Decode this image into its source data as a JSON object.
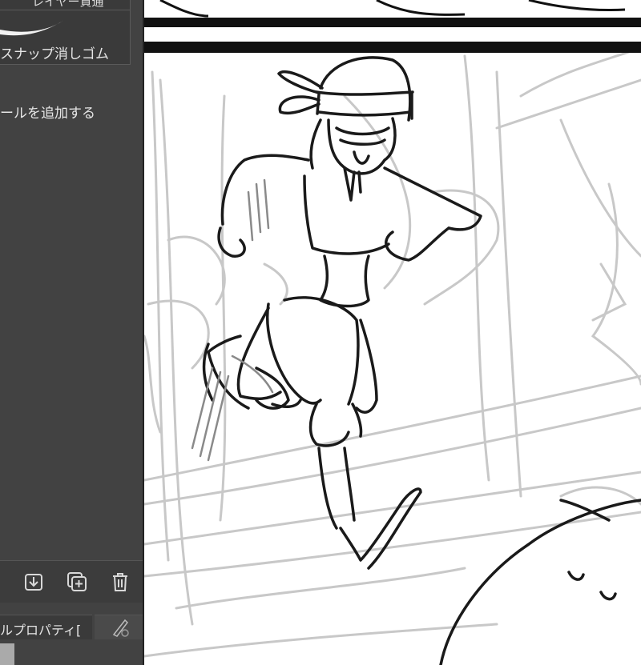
{
  "sidebar": {
    "top_item_label": "レイヤー貫通",
    "snap_eraser_label": "スナップ消しゴム",
    "add_tool_label": "ールを追加する",
    "tool_property_tab": "ルプロパティ["
  },
  "icons": {
    "merge": "merge-down-icon",
    "new": "new-layer-icon",
    "delete": "trash-icon",
    "brush": "brush-tab-icon"
  },
  "colors": {
    "panel_bg": "#424242",
    "sketch_dark": "#1a1a1a",
    "sketch_light": "#c8c8c8"
  }
}
